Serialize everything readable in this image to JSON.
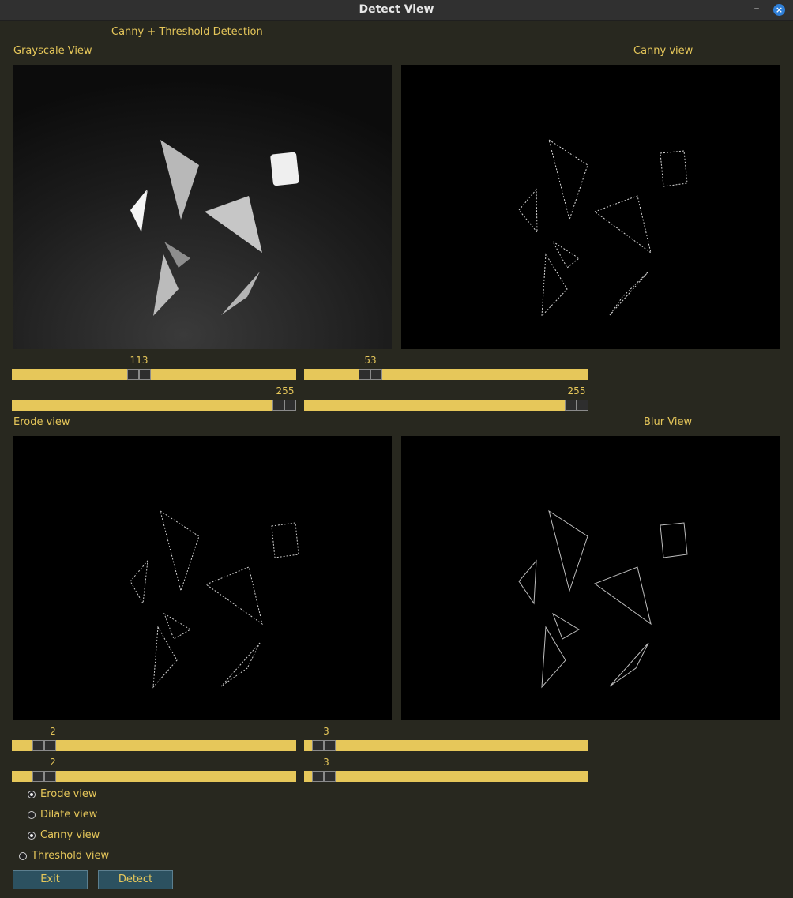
{
  "window": {
    "title": "Detect View",
    "minimize_glyph": "–",
    "close_glyph": "×"
  },
  "header": {
    "heading": "Canny + Threshold Detection"
  },
  "views": {
    "grayscale": "Grayscale View",
    "canny": "Canny view",
    "erode": "Erode view",
    "blur": "Blur View"
  },
  "sliders": {
    "canny_low": {
      "value": 113,
      "max": 255
    },
    "canny_low_top": {
      "value": 255,
      "max": 255
    },
    "canny_high": {
      "value": 53,
      "max": 255
    },
    "canny_high_top": {
      "value": 255,
      "max": 255
    },
    "erode_a": {
      "value": 2,
      "max": 25
    },
    "erode_b": {
      "value": 2,
      "max": 25
    },
    "blur_a": {
      "value": 3,
      "max": 100
    },
    "blur_b": {
      "value": 3,
      "max": 100
    }
  },
  "radios": [
    {
      "label": "Erode view",
      "checked": true
    },
    {
      "label": "Dilate view",
      "checked": false
    },
    {
      "label": "Canny view",
      "checked": true
    },
    {
      "label": "Threshold view",
      "checked": false
    }
  ],
  "buttons": {
    "exit": "Exit",
    "detect": "Detect"
  },
  "colors": {
    "background": "#28281f",
    "accent": "#e6c75a",
    "button": "#2c5160"
  }
}
